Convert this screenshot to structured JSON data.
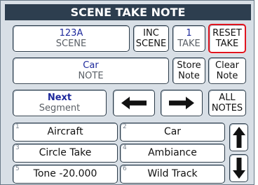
{
  "title": "SCENE TAKE NOTE",
  "scene": {
    "value": "123A",
    "label": "SCENE"
  },
  "inc_scene": {
    "line1": "INC",
    "line2": "SCENE"
  },
  "take": {
    "value": "1",
    "label": "TAKE"
  },
  "reset_take": {
    "line1": "RESET",
    "line2": "TAKE"
  },
  "note": {
    "value": "Car",
    "label": "NOTE"
  },
  "store_note": {
    "line1": "Store",
    "line2": "Note"
  },
  "clear_note": {
    "line1": "Clear",
    "line2": "Note"
  },
  "next_segment": {
    "line1": "Next",
    "line2": "Segment"
  },
  "all_notes": {
    "line1": "ALL",
    "line2": "NOTES"
  },
  "note_items": [
    {
      "num": "1",
      "label": "Aircraft"
    },
    {
      "num": "2",
      "label": "Car"
    },
    {
      "num": "3",
      "label": "Circle Take"
    },
    {
      "num": "4",
      "label": "Ambiance"
    },
    {
      "num": "5",
      "label": "Tone -20.000"
    },
    {
      "num": "6",
      "label": "Wild Track"
    }
  ],
  "colors": {
    "title_bg": "#2d3e4f",
    "value_text": "#1e2a9c",
    "highlight": "#e0141e"
  }
}
